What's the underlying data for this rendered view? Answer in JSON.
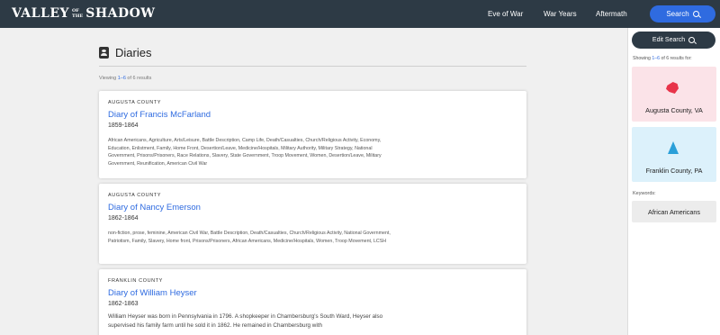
{
  "header": {
    "logo": {
      "left": "VALLEY",
      "of": "OF",
      "the": "THE",
      "right": "SHADOW"
    },
    "nav": [
      "Eve of War",
      "War Years",
      "Aftermath"
    ],
    "search_label": "Search",
    "search_icon": "search-icon"
  },
  "main": {
    "title": "Diaries",
    "title_icon": "diary-icon",
    "viewing": {
      "prefix": "Viewing ",
      "range": "1–6",
      "suffix": " of 6 results"
    },
    "results": [
      {
        "county": "AUGUSTA COUNTY",
        "title": "Diary of Francis McFarland",
        "years": "1859-1864",
        "tags": "African Americans, Agriculture, Arts/Leisure, Battle Description, Camp Life, Death/Casualties, Church/Religious Activity, Economy, Education, Enlistment, Family, Home Front, Desertion/Leave, Medicine/Hospitals, Military Authority, Military Strategy, National Government, Prisons/Prisoners, Race Relations, Slavery, State Government, Troop Movement, Women, Desertion/Leave, Military Government, Reunification, American Civil War"
      },
      {
        "county": "AUGUSTA COUNTY",
        "title": "Diary of Nancy Emerson",
        "years": "1862-1864",
        "tags": "non-fiction, prose, feminine, American Civil War, Battle Description, Death/Casualties, Church/Religious Activity, National Government, Patriotism, Family, Slavery, Home front, Prisons/Prisoners, African Americans, Medicine/Hospitals, Women, Troop Movement, LCSH"
      },
      {
        "county": "FRANKLIN COUNTY",
        "title": "Diary of William Heyser",
        "years": "1862-1863",
        "description": "William Heyser was born in Pennsylvania in 1796. A shopkeeper in Chambersburg's South Ward, Heyser also supervised his family farm until he sold it in 1862. He remained in Chambersburg with"
      }
    ]
  },
  "sidebar": {
    "edit_label": "Edit Search",
    "showing": {
      "prefix": "Showing ",
      "range": "1–6",
      "suffix": " of 6 results for:"
    },
    "counties": [
      {
        "name": "Augusta County, VA",
        "color": "#e8344a"
      },
      {
        "name": "Franklin County, PA",
        "color": "#2a9fd8"
      }
    ],
    "keywords_label": "Keywords:",
    "keyword": "African Americans"
  },
  "colors": {
    "header_bg": "#2d3a45",
    "accent": "#2f6be0",
    "page_bg": "#f0f0f0"
  }
}
